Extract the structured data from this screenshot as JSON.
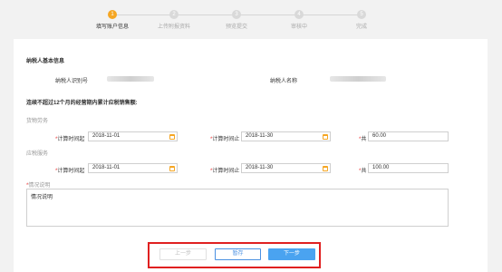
{
  "steps": [
    {
      "num": "1",
      "label": "填写账户信息",
      "active": true
    },
    {
      "num": "2",
      "label": "上传附报资料",
      "active": false
    },
    {
      "num": "3",
      "label": "预览提交",
      "active": false
    },
    {
      "num": "4",
      "label": "审核中",
      "active": false
    },
    {
      "num": "5",
      "label": "完成",
      "active": false
    }
  ],
  "taxpayer": {
    "section_title": "纳税人基本信息",
    "id_label": "纳税人识别号",
    "name_label": "纳税人名称"
  },
  "sales": {
    "section_title": "连续不超过12个月的经营期内累计应税销售额:",
    "goods": {
      "group_label": "货物劳务",
      "start_label": "计算时间起",
      "start_value": "2018-11-01",
      "end_label": "计算时间止",
      "end_value": "2018-11-30",
      "total_label": "共",
      "total_value": "60.00"
    },
    "services": {
      "group_label": "应税服务",
      "start_label": "计算时间起",
      "start_value": "2018-11-01",
      "end_label": "计算时间止",
      "end_value": "2018-11-30",
      "total_label": "共",
      "total_value": "100.00"
    }
  },
  "explanation": {
    "label": "情况说明",
    "value": "情况说明"
  },
  "buttons": {
    "prev": "上一步",
    "save": "暂存",
    "next": "下一步"
  },
  "colors": {
    "active_step": "#f5a623",
    "primary": "#4aa3f0",
    "required": "#e33333",
    "highlight_frame": "#e02020"
  }
}
